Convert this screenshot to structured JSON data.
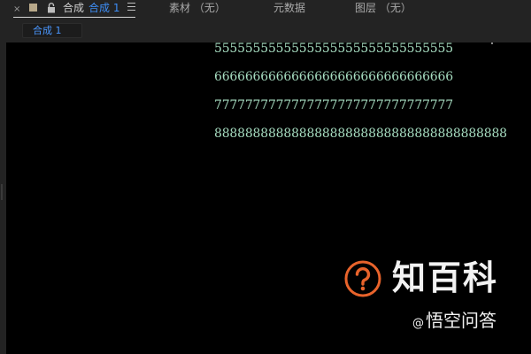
{
  "panel": {
    "close_glyph": "×",
    "comp_tab": {
      "title": "合成",
      "active_name": "合成 1"
    },
    "tabs": [
      {
        "label": "素材  （无）"
      },
      {
        "label": "元数据"
      },
      {
        "label": "图层  （无）"
      }
    ]
  },
  "viewer": {
    "comp_subtab": "合成 1",
    "text_lines": [
      "5555555555555555555555555555555",
      "6666666666666666666666666666666",
      "7777777777777777777777777777777",
      "88888888888888888888888888888888888888"
    ],
    "text_color": "#a6dcc0",
    "background": "#000000"
  },
  "watermark": {
    "brand": "知百科",
    "wukong_at": "@",
    "wukong": "悟空问答",
    "logo_icon": "question-mark-circle-icon",
    "logo_color": "#e8632b"
  },
  "colors": {
    "accent": "#3d8df5",
    "panel_bg": "#232323",
    "swatch": "#b9a98a"
  }
}
